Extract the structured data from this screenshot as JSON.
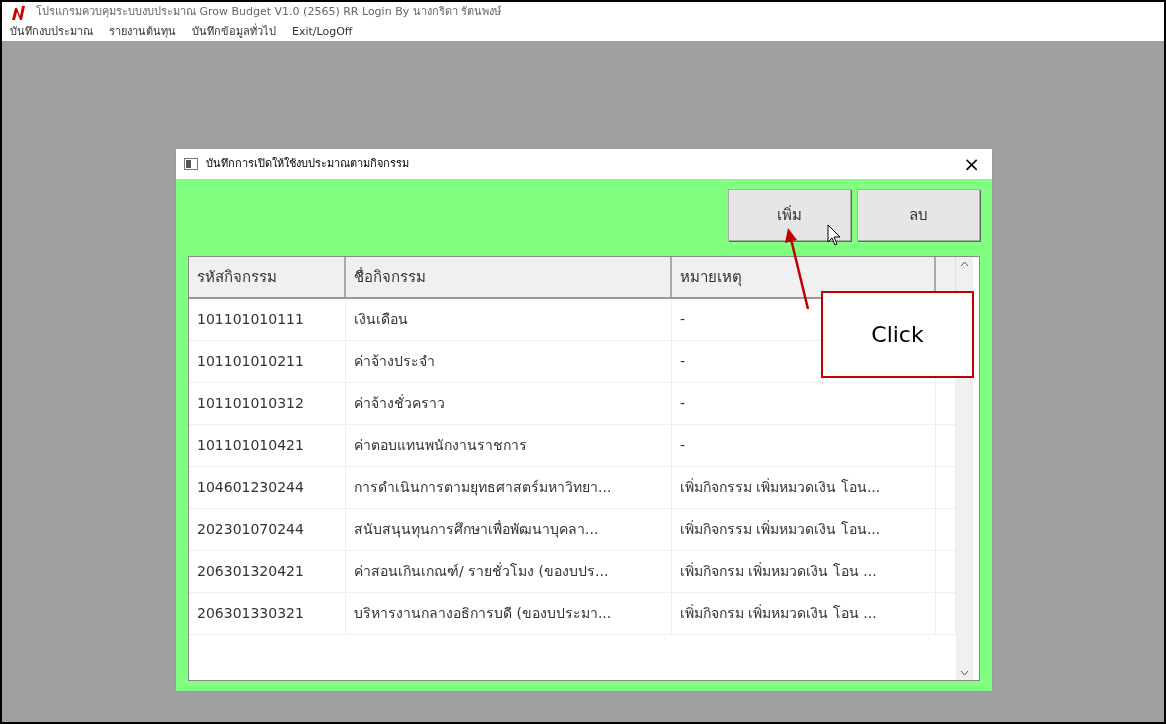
{
  "window": {
    "title": "โปรแกรมควบคุมระบบงบประมาณ Grow Budget V1.0 (2565) RR  Login By นางกริดา รัตนพงษ์"
  },
  "menu": [
    "บันทึกงบประมาณ",
    "รายงานต้นทุน",
    "บันทึกข้อมูลทั่วไป",
    "Exit/LogOff"
  ],
  "dialog": {
    "title": "บันทึกการเปิดให้ใช้งบประมาณตามกิจกรรม",
    "close": "×",
    "buttons": [
      "เพิ่ม",
      "ลบ"
    ],
    "table": {
      "columns": [
        "รหัสกิจกรรม",
        "ชื่อกิจกรรม",
        "หมายเหตุ"
      ],
      "rows": [
        [
          "101101010111",
          "เงินเดือน",
          "-"
        ],
        [
          "101101010211",
          "ค่าจ้างประจำ",
          "-"
        ],
        [
          "101101010312",
          "ค่าจ้างชั่วคราว",
          "-"
        ],
        [
          "101101010421",
          "ค่าตอบแทนพนักงานราชการ",
          "-"
        ],
        [
          "104601230244",
          "การดำเนินการตามยุทธศาสตร์มหาวิทยา...",
          "เพิ่มกิจกรรม เพิ่มหมวดเงิน โอน..."
        ],
        [
          "202301070244",
          "สนับสนุนทุนการศึกษาเพื่อพัฒนาบุคลา...",
          "เพิ่มกิจกรรม เพิ่มหมวดเงิน โอน..."
        ],
        [
          "206301320421",
          "ค่าสอนเกินเกณฑ์/ รายชั่วโมง (ของบปร...",
          "เพิ่มกิจกรม เพิ่มหมวดเงิน โอน ..."
        ],
        [
          "206301330321",
          "บริหารงานกลางอธิการบดี (ของบประมา...",
          "เพิ่มกิจกรม เพิ่มหมวดเงิน โอน ..."
        ]
      ]
    }
  },
  "annotation": {
    "text": "Click"
  }
}
